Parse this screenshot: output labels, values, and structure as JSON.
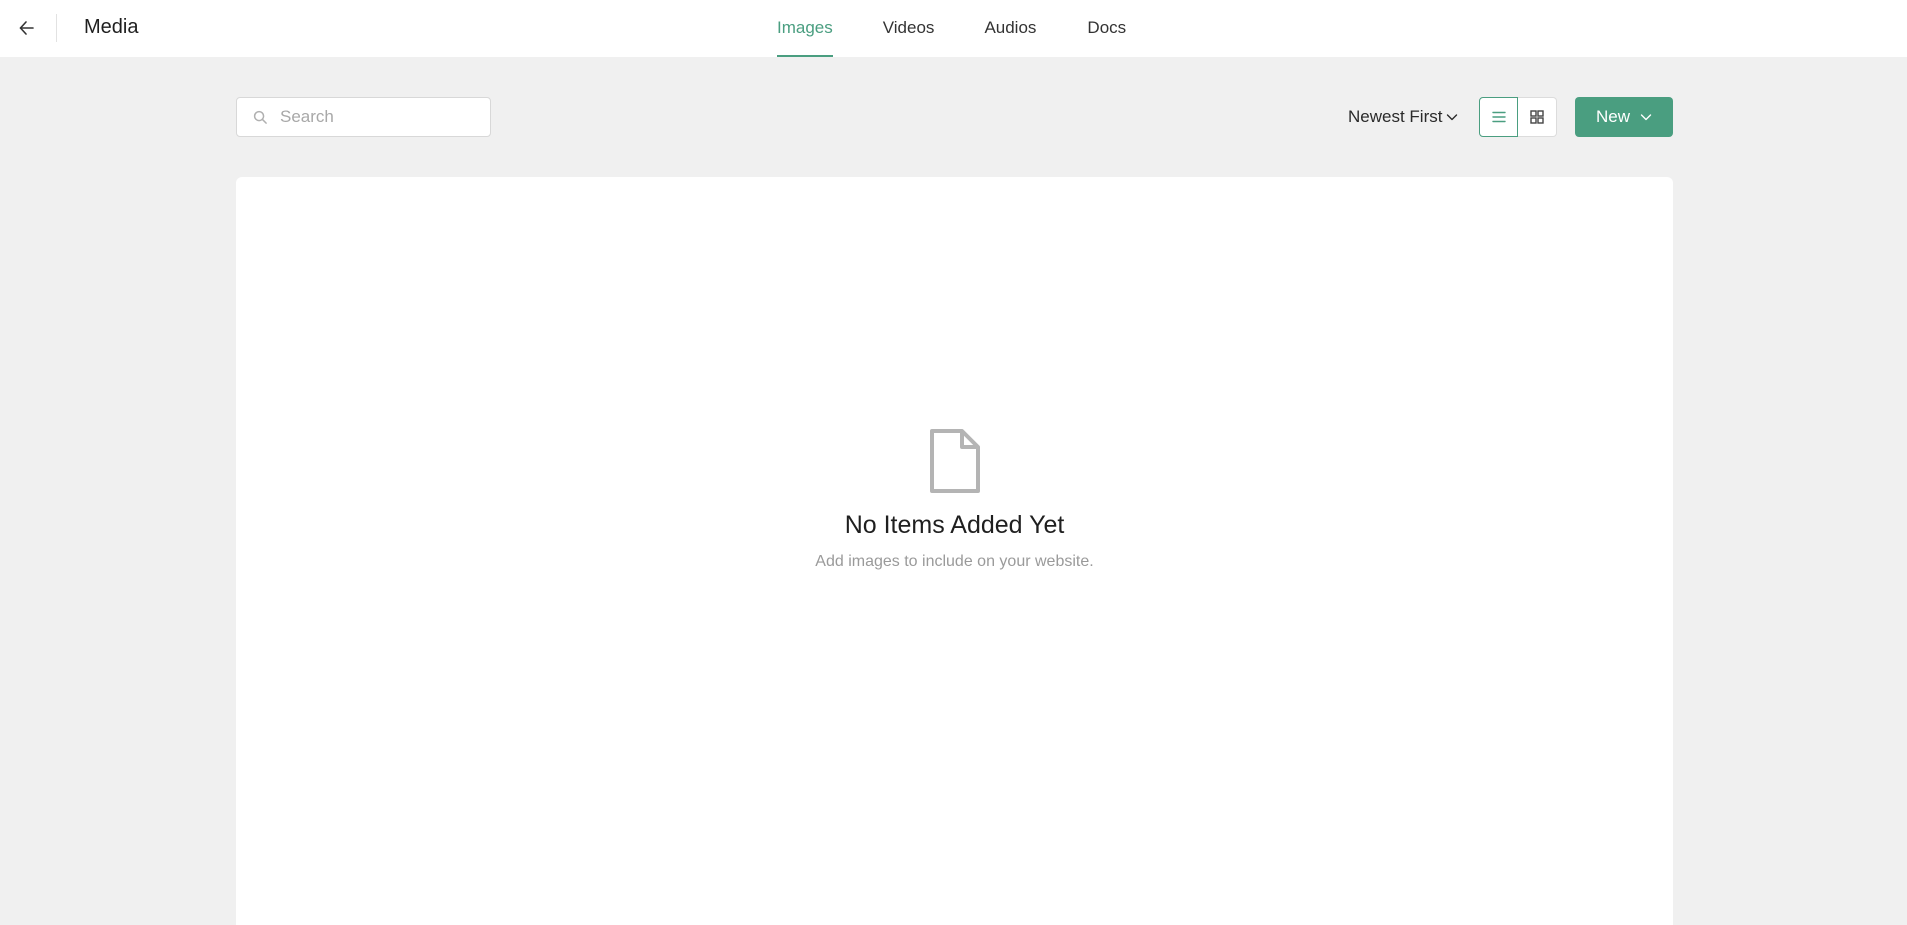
{
  "header": {
    "back_icon": "arrow-left-icon",
    "title": "Media",
    "tabs": [
      {
        "label": "Images",
        "active": true
      },
      {
        "label": "Videos",
        "active": false
      },
      {
        "label": "Audios",
        "active": false
      },
      {
        "label": "Docs",
        "active": false
      }
    ]
  },
  "toolbar": {
    "search": {
      "placeholder": "Search",
      "value": ""
    },
    "sort": {
      "selected": "Newest First"
    },
    "view_modes": [
      "list",
      "grid"
    ],
    "active_view": "list",
    "new_button_label": "New"
  },
  "empty_state": {
    "icon": "file-icon",
    "title": "No Items Added Yet",
    "subtitle": "Add images to include on your website."
  },
  "colors": {
    "accent": "#4a9e80",
    "background": "#f0f0f0",
    "panel": "#ffffff"
  }
}
